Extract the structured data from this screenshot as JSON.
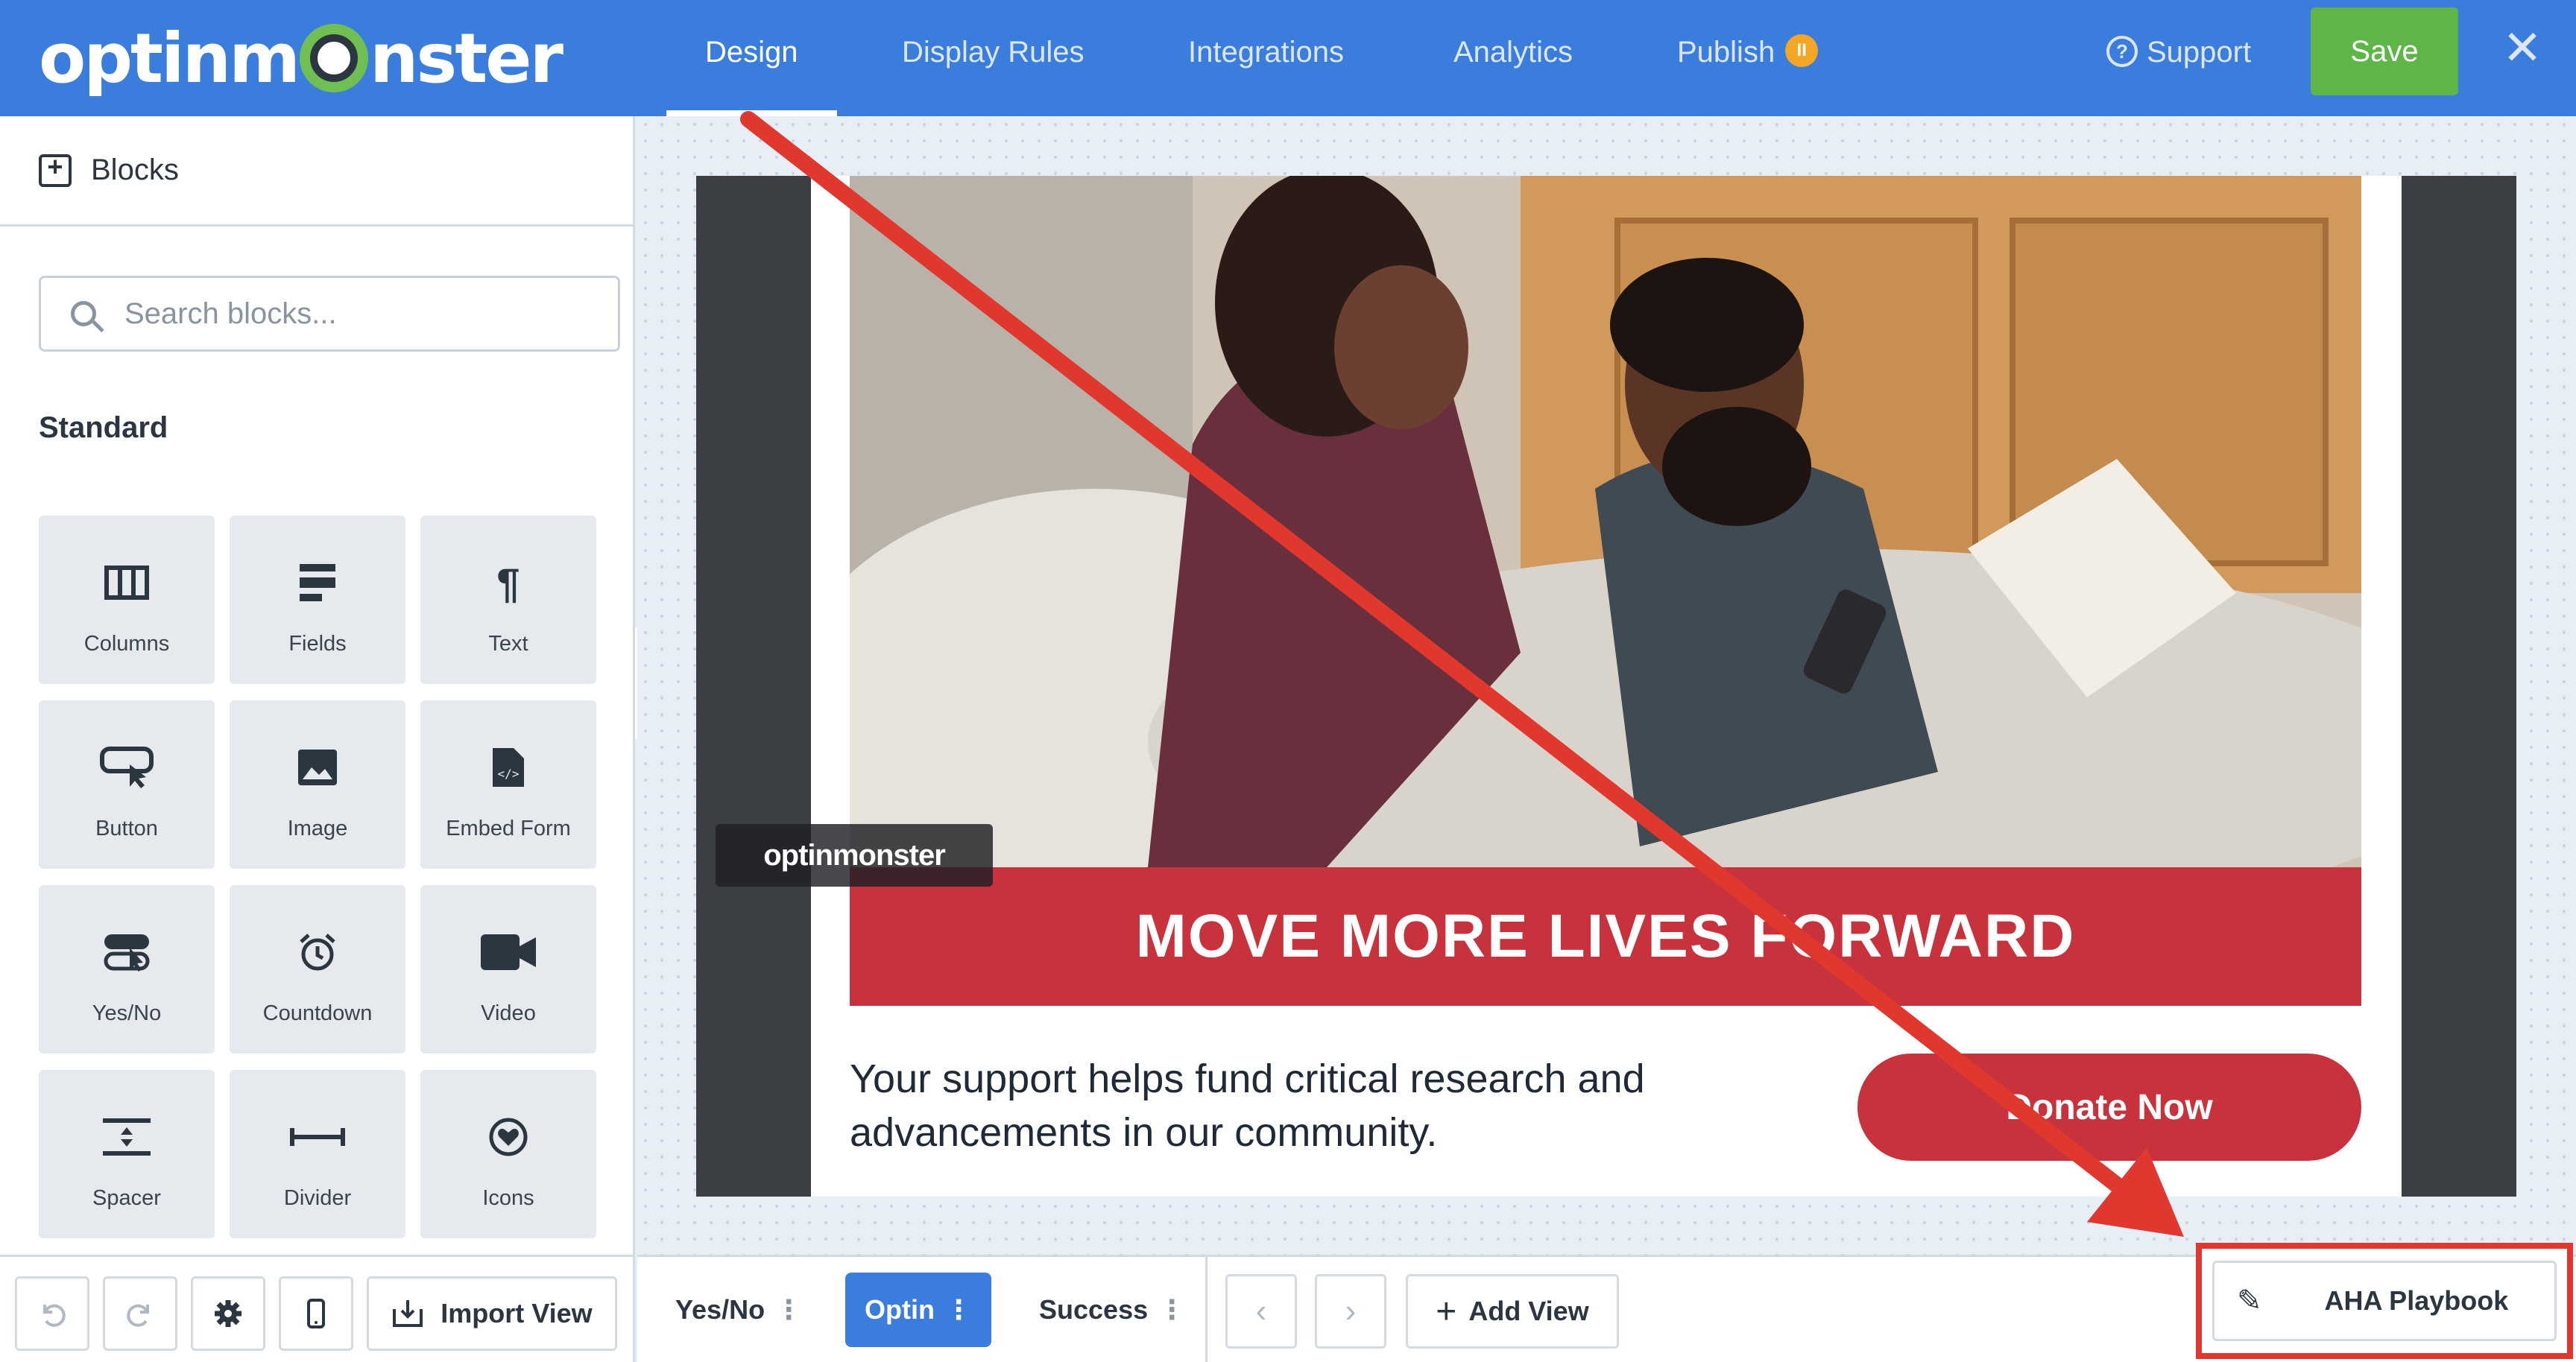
{
  "app": {
    "logo_text": "optinmonster"
  },
  "nav": {
    "tabs": [
      {
        "label": "Design",
        "active": true
      },
      {
        "label": "Display Rules",
        "active": false
      },
      {
        "label": "Integrations",
        "active": false
      },
      {
        "label": "Analytics",
        "active": false
      },
      {
        "label": "Publish",
        "active": false
      }
    ],
    "publish_badge_icon": "pause-icon",
    "support_label": "Support",
    "save_label": "Save",
    "close_icon": "close-icon"
  },
  "sidebar": {
    "header": "Blocks",
    "search_placeholder": "Search blocks...",
    "section_title": "Standard",
    "blocks": [
      {
        "label": "Columns",
        "icon": "columns-icon"
      },
      {
        "label": "Fields",
        "icon": "fields-icon"
      },
      {
        "label": "Text",
        "icon": "paragraph-icon"
      },
      {
        "label": "Button",
        "icon": "button-icon"
      },
      {
        "label": "Image",
        "icon": "image-icon"
      },
      {
        "label": "Embed Form",
        "icon": "embed-form-icon"
      },
      {
        "label": "Yes/No",
        "icon": "toggle-icon"
      },
      {
        "label": "Countdown",
        "icon": "alarm-clock-icon"
      },
      {
        "label": "Video",
        "icon": "video-camera-icon"
      },
      {
        "label": "Spacer",
        "icon": "spacer-icon"
      },
      {
        "label": "Divider",
        "icon": "divider-icon"
      },
      {
        "label": "Icons",
        "icon": "heart-icon"
      }
    ]
  },
  "campaign": {
    "headline": "MOVE MORE LIVES FORWARD",
    "body_text": "Your support helps fund critical research and advancements in our community.",
    "button_label": "Donate Now",
    "watermark": "optinmonster"
  },
  "bottom_bar": {
    "import_view_label": "Import View",
    "views": [
      {
        "label": "Yes/No",
        "active": false
      },
      {
        "label": "Optin",
        "active": true
      },
      {
        "label": "Success",
        "active": false
      }
    ],
    "add_view_label": "Add View",
    "playbook_label": "AHA Playbook"
  },
  "colors": {
    "brand_blue": "#3b7ddd",
    "save_green": "#5fb648",
    "campaign_red": "#c8323c",
    "annotation_red": "#e0382f"
  }
}
